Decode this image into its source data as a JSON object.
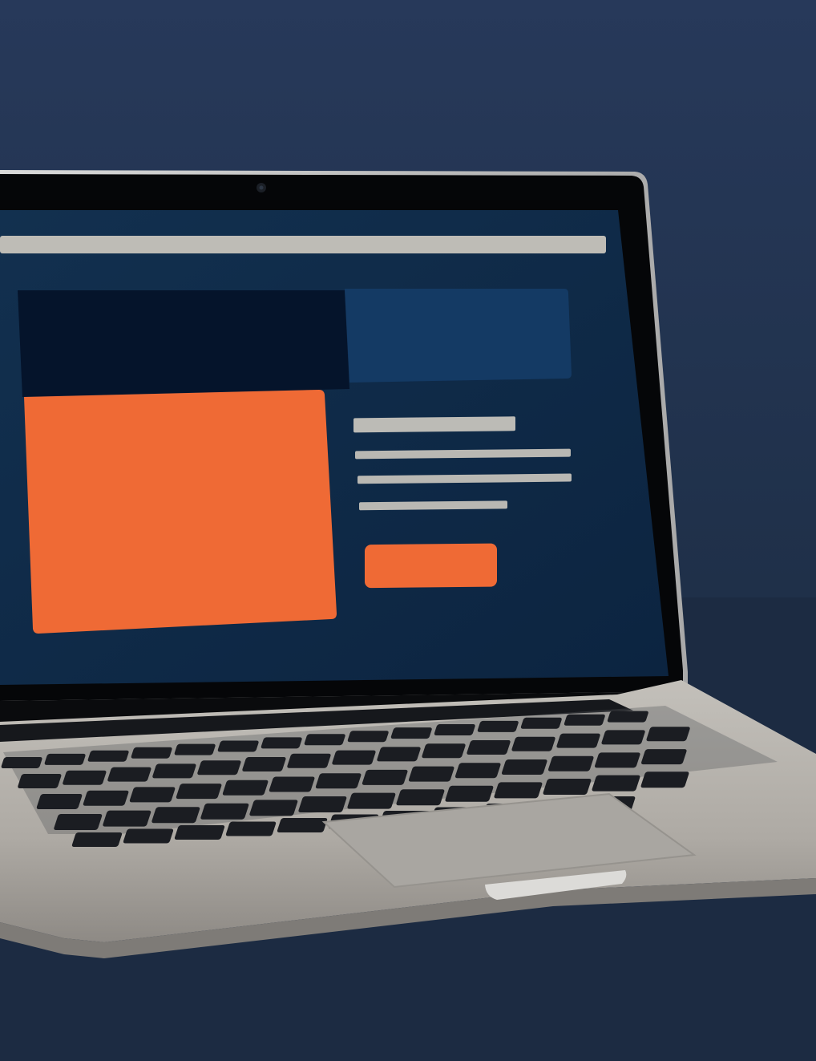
{
  "scene": {
    "subject": "laptop-with-website-wireframe",
    "colors": {
      "background_upper": "#243650",
      "background_lower": "#1b2a40",
      "tabletop": "#1d2d44",
      "screen_background": "#0f2a48",
      "screen_header_dark": "#06162d",
      "screen_header_blue": "#133a63",
      "accent_orange": "#ef6a35",
      "placeholder_gray": "#b9b9b4",
      "laptop_silver": "#b8b4ae",
      "keyboard_keys": "#1a1c21"
    }
  },
  "wireframe": {
    "elements": [
      "address-bar",
      "hero-dark-panel",
      "hero-blue-panel",
      "orange-image-block",
      "heading-line",
      "text-line",
      "text-line",
      "text-line",
      "orange-cta-button"
    ]
  }
}
